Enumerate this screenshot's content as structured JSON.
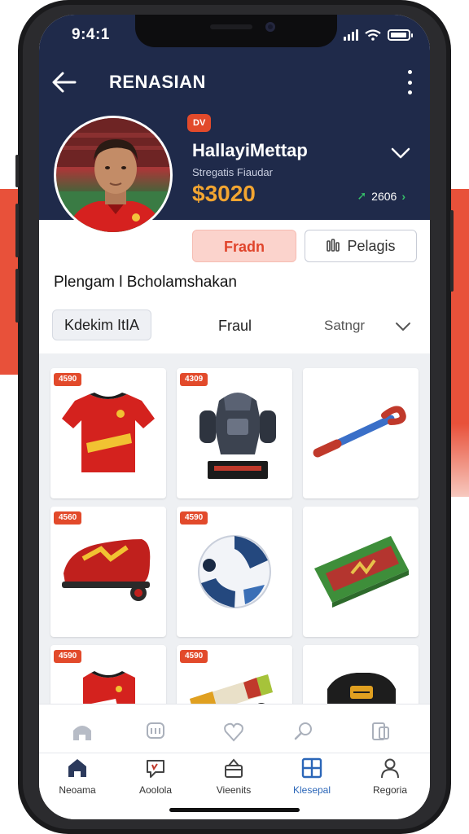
{
  "status": {
    "time": "9:4:1"
  },
  "nav": {
    "title": "RENASIAN"
  },
  "player": {
    "badge": "DV",
    "name": "HallayiMettap",
    "subtitle": "Stregatis Fiaudar",
    "price": "$3020",
    "trend_value": "2606"
  },
  "actions": {
    "trade_label": "Fradn",
    "details_label": "Pelagis"
  },
  "section": {
    "title": "Plengam l Bcholamshakan"
  },
  "filters": {
    "chip_label": "Kdekim ItIA",
    "filter_label": "Fraul",
    "sort_label": "Satngr"
  },
  "products": [
    {
      "price": "4590",
      "icon": "jersey-icon"
    },
    {
      "price": "4309",
      "icon": "armor-trophy-icon"
    },
    {
      "price": "",
      "icon": "bat-icon"
    },
    {
      "price": "4560",
      "icon": "boot-icon"
    },
    {
      "price": "4590",
      "icon": "ball-icon"
    },
    {
      "price": "",
      "icon": "bag-icon"
    },
    {
      "price": "4590",
      "icon": "jersey-icon"
    },
    {
      "price": "4590",
      "icon": "tape-icon"
    },
    {
      "price": "",
      "icon": "shirt-icon"
    }
  ],
  "tabbar": {
    "items": [
      {
        "label": "Neoama",
        "icon": "home-icon"
      },
      {
        "label": "Aoolola",
        "icon": "chat-icon"
      },
      {
        "label": "Vieenits",
        "icon": "gift-icon"
      },
      {
        "label": "Klesepal",
        "icon": "grid-icon"
      },
      {
        "label": "Regoria",
        "icon": "person-icon"
      }
    ],
    "active_index": 3
  },
  "colors": {
    "header": "#1f2a4a",
    "accent": "#e24a2b",
    "price_gold": "#f2a531",
    "active_tab": "#2b66b8"
  }
}
